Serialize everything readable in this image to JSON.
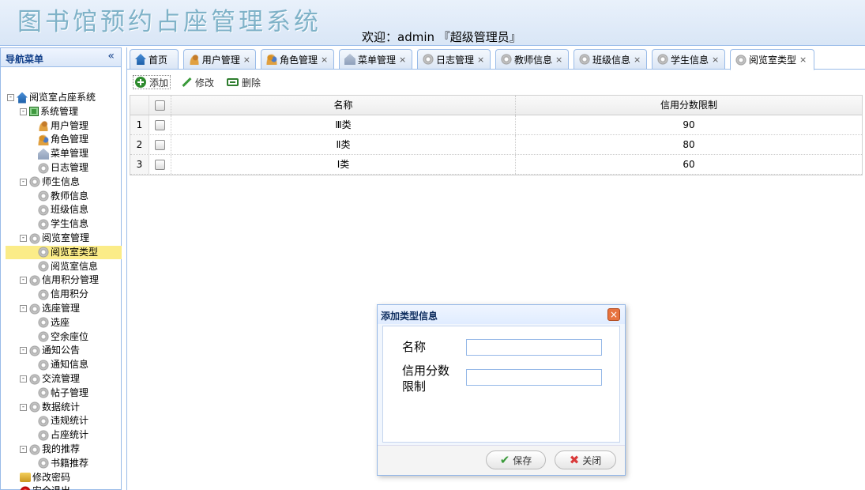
{
  "header": {
    "app_title": "图书馆预约占座管理系统",
    "welcome_text": "欢迎：admin 『超级管理员』"
  },
  "sidebar": {
    "title": "导航菜单",
    "collapse_glyph": "«",
    "tree": [
      {
        "label": "阅览室占座系统",
        "icon": "home-icon",
        "level": 0,
        "toggle": "-"
      },
      {
        "label": "系统管理",
        "icon": "system-icon",
        "level": 1,
        "toggle": "-"
      },
      {
        "label": "用户管理",
        "icon": "user-icon",
        "level": 2
      },
      {
        "label": "角色管理",
        "icon": "role-icon",
        "level": 2
      },
      {
        "label": "菜单管理",
        "icon": "menu-icon",
        "level": 2
      },
      {
        "label": "日志管理",
        "icon": "gear-icon",
        "level": 2
      },
      {
        "label": "师生信息",
        "icon": "gear-icon",
        "level": 1,
        "toggle": "-"
      },
      {
        "label": "教师信息",
        "icon": "gear-icon",
        "level": 2
      },
      {
        "label": "班级信息",
        "icon": "gear-icon",
        "level": 2
      },
      {
        "label": "学生信息",
        "icon": "gear-icon",
        "level": 2
      },
      {
        "label": "阅览室管理",
        "icon": "gear-icon",
        "level": 1,
        "toggle": "-"
      },
      {
        "label": "阅览室类型",
        "icon": "gear-icon",
        "level": 2,
        "selected": true
      },
      {
        "label": "阅览室信息",
        "icon": "gear-icon",
        "level": 2
      },
      {
        "label": "信用积分管理",
        "icon": "gear-icon",
        "level": 1,
        "toggle": "-"
      },
      {
        "label": "信用积分",
        "icon": "gear-icon",
        "level": 2
      },
      {
        "label": "选座管理",
        "icon": "gear-icon",
        "level": 1,
        "toggle": "-"
      },
      {
        "label": "选座",
        "icon": "gear-icon",
        "level": 2
      },
      {
        "label": "空余座位",
        "icon": "gear-icon",
        "level": 2
      },
      {
        "label": "通知公告",
        "icon": "gear-icon",
        "level": 1,
        "toggle": "-"
      },
      {
        "label": "通知信息",
        "icon": "gear-icon",
        "level": 2
      },
      {
        "label": "交流管理",
        "icon": "gear-icon",
        "level": 1,
        "toggle": "-"
      },
      {
        "label": "帖子管理",
        "icon": "gear-icon",
        "level": 2
      },
      {
        "label": "数据统计",
        "icon": "gear-icon",
        "level": 1,
        "toggle": "-"
      },
      {
        "label": "违规统计",
        "icon": "gear-icon",
        "level": 2
      },
      {
        "label": "占座统计",
        "icon": "gear-icon",
        "level": 2
      },
      {
        "label": "我的推荐",
        "icon": "gear-icon",
        "level": 1,
        "toggle": "-"
      },
      {
        "label": "书籍推荐",
        "icon": "gear-icon",
        "level": 2
      },
      {
        "label": "修改密码",
        "icon": "key-icon",
        "level": 1
      },
      {
        "label": "安全退出",
        "icon": "exit-icon",
        "level": 1
      }
    ]
  },
  "tabs": [
    {
      "label": "首页",
      "icon": "home-icon",
      "closable": false
    },
    {
      "label": "用户管理",
      "icon": "user-icon",
      "closable": true
    },
    {
      "label": "角色管理",
      "icon": "role-icon",
      "closable": true
    },
    {
      "label": "菜单管理",
      "icon": "menu-icon",
      "closable": true
    },
    {
      "label": "日志管理",
      "icon": "gear-icon",
      "closable": true
    },
    {
      "label": "教师信息",
      "icon": "gear-icon",
      "closable": true
    },
    {
      "label": "班级信息",
      "icon": "gear-icon",
      "closable": true
    },
    {
      "label": "学生信息",
      "icon": "gear-icon",
      "closable": true
    },
    {
      "label": "阅览室类型",
      "icon": "gear-icon",
      "closable": true,
      "active": true
    }
  ],
  "close_glyph": "×",
  "toolbar": {
    "add_label": "添加",
    "edit_label": "修改",
    "delete_label": "删除"
  },
  "grid": {
    "columns": [
      "名称",
      "信用分数限制"
    ],
    "rows": [
      {
        "num": "1",
        "name": "Ⅲ类",
        "limit": "90"
      },
      {
        "num": "2",
        "name": "Ⅱ类",
        "limit": "80"
      },
      {
        "num": "3",
        "name": "Ⅰ类",
        "limit": "60"
      }
    ]
  },
  "dialog": {
    "title": "添加类型信息",
    "close_glyph": "×",
    "fields": {
      "name_label": "名称",
      "name_value": "",
      "limit_label_line1": "信用分数",
      "limit_label_line2": "限制",
      "limit_value": ""
    },
    "save_label": "保存",
    "close_label": "关闭"
  },
  "colors": {
    "border": "#99bbe8",
    "selected_row": "#fbec88",
    "title_color": "#7fb2c8"
  }
}
